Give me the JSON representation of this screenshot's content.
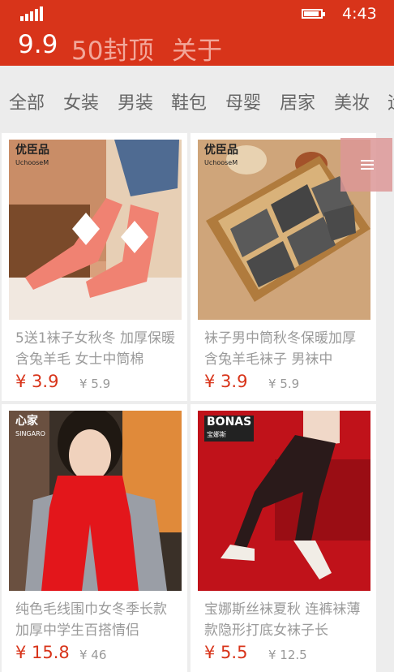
{
  "status": {
    "time": "4:43"
  },
  "top_tabs": [
    "9.9",
    "50封顶",
    "关于"
  ],
  "categories": [
    "全部",
    "女装",
    "男装",
    "鞋包",
    "母婴",
    "居家",
    "美妆",
    "运"
  ],
  "products": [
    {
      "brand": "优臣品",
      "brand_sub": "UchooseM",
      "title": "5送1袜子女秋冬 加厚保暖含兔羊毛 女士中筒棉",
      "price": "¥ 3.9",
      "orig_price": "¥ 5.9"
    },
    {
      "brand": "优臣品",
      "brand_sub": "UchooseM",
      "title": "袜子男中筒秋冬保暖加厚含兔羊毛袜子 男袜中",
      "price": "¥ 3.9",
      "orig_price": "¥ 5.9"
    },
    {
      "brand": "心家",
      "brand_sub": "SINGARO",
      "title": "纯色毛线围巾女冬季长款加厚中学生百搭情侣",
      "price": "¥ 15.8",
      "orig_price": "¥ 46"
    },
    {
      "brand": "BONAS",
      "brand_sub": "宝娜斯",
      "title": "宝娜斯丝袜夏秋 连裤袜薄款隐形打底女袜子长",
      "price": "¥ 5.5",
      "orig_price": "¥ 12.5"
    }
  ],
  "colors": {
    "accent": "#d8341a",
    "inactive_tab": "#f2a79a"
  }
}
